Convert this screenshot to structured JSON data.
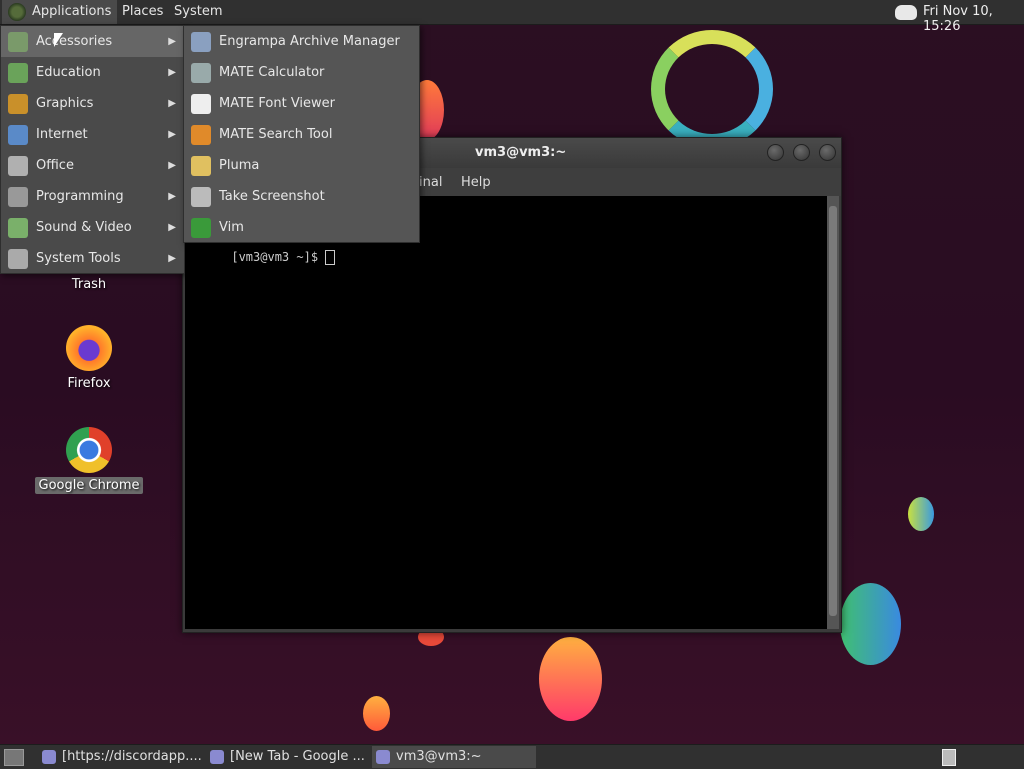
{
  "top_panel": {
    "applications": "Applications",
    "places": "Places",
    "system": "System",
    "clock": "Fri Nov 10, 15:26"
  },
  "apps_menu": {
    "items": [
      {
        "label": "Accessories",
        "icon": "accessories-icon",
        "color": "#7a9a6a"
      },
      {
        "label": "Education",
        "icon": "education-icon",
        "color": "#6aa35a"
      },
      {
        "label": "Graphics",
        "icon": "graphics-icon",
        "color": "#c9902a"
      },
      {
        "label": "Internet",
        "icon": "internet-icon",
        "color": "#5a8ac8"
      },
      {
        "label": "Office",
        "icon": "office-icon",
        "color": "#b0b0b0"
      },
      {
        "label": "Programming",
        "icon": "programming-icon",
        "color": "#999999"
      },
      {
        "label": "Sound & Video",
        "icon": "sound-video-icon",
        "color": "#7ab06a"
      },
      {
        "label": "System Tools",
        "icon": "system-tools-icon",
        "color": "#aaaaaa"
      }
    ]
  },
  "accessories_menu": {
    "items": [
      {
        "label": "Engrampa Archive Manager",
        "icon": "archive-manager-icon",
        "color": "#8aa0c0"
      },
      {
        "label": "MATE Calculator",
        "icon": "calculator-icon",
        "color": "#9aa"
      },
      {
        "label": "MATE Font Viewer",
        "icon": "font-viewer-icon",
        "color": "#eeeeee"
      },
      {
        "label": "MATE Search Tool",
        "icon": "search-tool-icon",
        "color": "#e08a2a"
      },
      {
        "label": "Pluma",
        "icon": "pluma-icon",
        "color": "#e0c060"
      },
      {
        "label": "Take Screenshot",
        "icon": "screenshot-icon",
        "color": "#bbbbbb"
      },
      {
        "label": "Vim",
        "icon": "vim-icon",
        "color": "#3a9a3a"
      }
    ]
  },
  "terminal": {
    "title": "vm3@vm3:~",
    "menu_partial": "inal",
    "menu_help": "Help",
    "prompt": "[vm3@vm3 ~]$ "
  },
  "desktop": {
    "trash": "Trash",
    "firefox": "Firefox",
    "chrome": "Google Chrome"
  },
  "taskbar": {
    "tasks": [
      {
        "label": "[https://discordapp....",
        "icon": "discord-icon"
      },
      {
        "label": "[New Tab - Google ...",
        "icon": "chrome-icon"
      },
      {
        "label": "vm3@vm3:~",
        "icon": "terminal-icon"
      }
    ]
  }
}
